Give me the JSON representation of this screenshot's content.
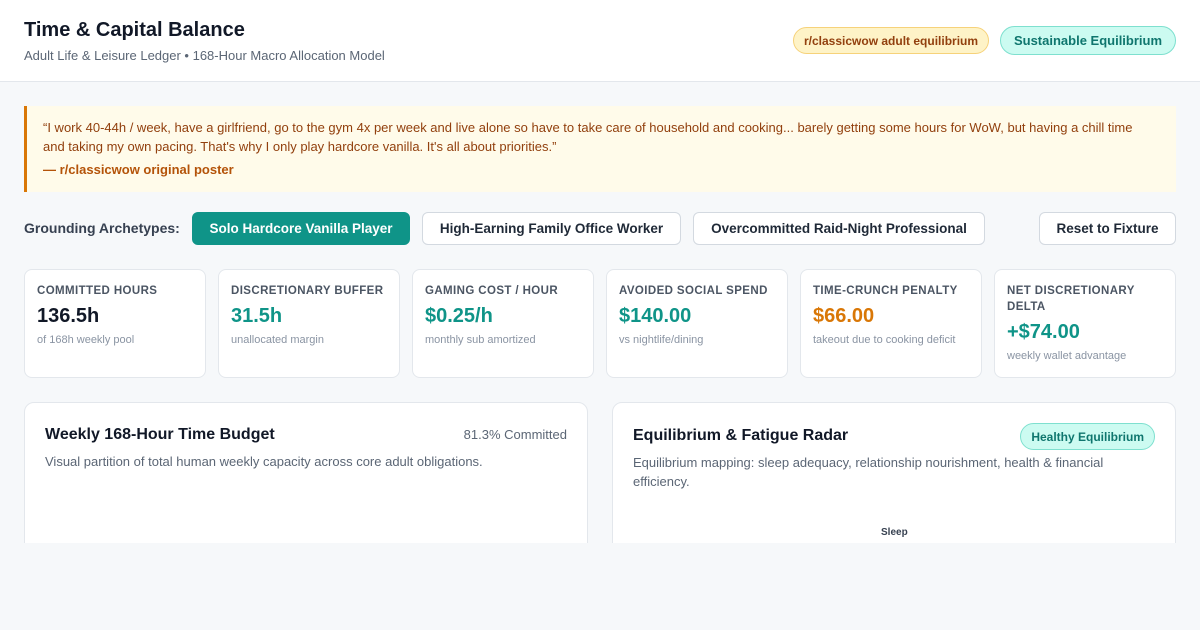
{
  "header": {
    "title": "Time & Capital Balance",
    "subtitle": "Adult Life & Leisure Ledger • 168-Hour Macro Allocation Model",
    "source_badge": "r/classicwow adult equilibrium",
    "status_badge": "Sustainable Equilibrium"
  },
  "quote": {
    "text": "“I work 40-44h / week, have a girlfriend, go to the gym 4x per week and live alone so have to take care of household and cooking... barely getting some hours for WoW, but having a chill time and taking my own pacing. That's why I only play hardcore vanilla. It's all about priorities.”",
    "author": "— r/classicwow original poster"
  },
  "archetypes": {
    "label": "Grounding Archetypes:",
    "options": [
      "Solo Hardcore Vanilla Player",
      "High-Earning Family Office Worker",
      "Overcommitted Raid-Night Professional"
    ],
    "selected": "Solo Hardcore Vanilla Player",
    "reset_label": "Reset to Fixture"
  },
  "metrics": [
    {
      "label": "Committed Hours",
      "value": "136.5h",
      "caption": "of 168h weekly pool",
      "tone": "dark"
    },
    {
      "label": "Discretionary Buffer",
      "value": "31.5h",
      "caption": "unallocated margin",
      "tone": "teal"
    },
    {
      "label": "Gaming Cost / Hour",
      "value": "$0.25/h",
      "caption": "monthly sub amortized",
      "tone": "teal"
    },
    {
      "label": "Avoided Social Spend",
      "value": "$140.00",
      "caption": "vs nightlife/dining",
      "tone": "teal"
    },
    {
      "label": "Time-Crunch Penalty",
      "value": "$66.00",
      "caption": "takeout due to cooking deficit",
      "tone": "orange"
    },
    {
      "label": "Net Discretionary Delta",
      "value": "+$74.00",
      "caption": "weekly wallet advantage",
      "tone": "teal"
    }
  ],
  "time_budget": {
    "title": "Weekly 168-Hour Time Budget",
    "committed": "81.3% Committed",
    "description": "Visual partition of total human weekly capacity across core adult obligations."
  },
  "radar": {
    "title": "Equilibrium & Fatigue Radar",
    "badge": "Healthy Equilibrium",
    "description": "Equilibrium mapping: sleep adequacy, relationship nourishment, health & financial efficiency.",
    "axis_labels": [
      "Sleep"
    ]
  },
  "colors": {
    "accent": "#0f9488",
    "warning": "#d97706",
    "status_bg": "#ccfbf1",
    "quote_bg": "#fffbea"
  }
}
